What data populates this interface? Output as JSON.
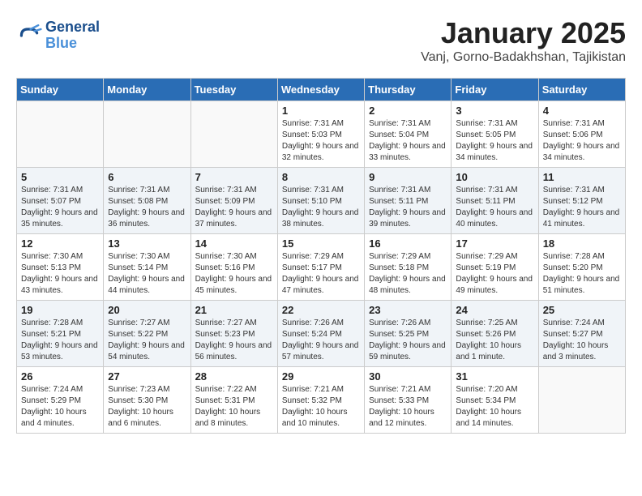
{
  "logo": {
    "line1": "General",
    "line2": "Blue"
  },
  "header": {
    "title": "January 2025",
    "subtitle": "Vanj, Gorno-Badakhshan, Tajikistan"
  },
  "weekdays": [
    "Sunday",
    "Monday",
    "Tuesday",
    "Wednesday",
    "Thursday",
    "Friday",
    "Saturday"
  ],
  "weeks": [
    [
      {
        "day": "",
        "info": ""
      },
      {
        "day": "",
        "info": ""
      },
      {
        "day": "",
        "info": ""
      },
      {
        "day": "1",
        "info": "Sunrise: 7:31 AM\nSunset: 5:03 PM\nDaylight: 9 hours and 32 minutes."
      },
      {
        "day": "2",
        "info": "Sunrise: 7:31 AM\nSunset: 5:04 PM\nDaylight: 9 hours and 33 minutes."
      },
      {
        "day": "3",
        "info": "Sunrise: 7:31 AM\nSunset: 5:05 PM\nDaylight: 9 hours and 34 minutes."
      },
      {
        "day": "4",
        "info": "Sunrise: 7:31 AM\nSunset: 5:06 PM\nDaylight: 9 hours and 34 minutes."
      }
    ],
    [
      {
        "day": "5",
        "info": "Sunrise: 7:31 AM\nSunset: 5:07 PM\nDaylight: 9 hours and 35 minutes."
      },
      {
        "day": "6",
        "info": "Sunrise: 7:31 AM\nSunset: 5:08 PM\nDaylight: 9 hours and 36 minutes."
      },
      {
        "day": "7",
        "info": "Sunrise: 7:31 AM\nSunset: 5:09 PM\nDaylight: 9 hours and 37 minutes."
      },
      {
        "day": "8",
        "info": "Sunrise: 7:31 AM\nSunset: 5:10 PM\nDaylight: 9 hours and 38 minutes."
      },
      {
        "day": "9",
        "info": "Sunrise: 7:31 AM\nSunset: 5:11 PM\nDaylight: 9 hours and 39 minutes."
      },
      {
        "day": "10",
        "info": "Sunrise: 7:31 AM\nSunset: 5:11 PM\nDaylight: 9 hours and 40 minutes."
      },
      {
        "day": "11",
        "info": "Sunrise: 7:31 AM\nSunset: 5:12 PM\nDaylight: 9 hours and 41 minutes."
      }
    ],
    [
      {
        "day": "12",
        "info": "Sunrise: 7:30 AM\nSunset: 5:13 PM\nDaylight: 9 hours and 43 minutes."
      },
      {
        "day": "13",
        "info": "Sunrise: 7:30 AM\nSunset: 5:14 PM\nDaylight: 9 hours and 44 minutes."
      },
      {
        "day": "14",
        "info": "Sunrise: 7:30 AM\nSunset: 5:16 PM\nDaylight: 9 hours and 45 minutes."
      },
      {
        "day": "15",
        "info": "Sunrise: 7:29 AM\nSunset: 5:17 PM\nDaylight: 9 hours and 47 minutes."
      },
      {
        "day": "16",
        "info": "Sunrise: 7:29 AM\nSunset: 5:18 PM\nDaylight: 9 hours and 48 minutes."
      },
      {
        "day": "17",
        "info": "Sunrise: 7:29 AM\nSunset: 5:19 PM\nDaylight: 9 hours and 49 minutes."
      },
      {
        "day": "18",
        "info": "Sunrise: 7:28 AM\nSunset: 5:20 PM\nDaylight: 9 hours and 51 minutes."
      }
    ],
    [
      {
        "day": "19",
        "info": "Sunrise: 7:28 AM\nSunset: 5:21 PM\nDaylight: 9 hours and 53 minutes."
      },
      {
        "day": "20",
        "info": "Sunrise: 7:27 AM\nSunset: 5:22 PM\nDaylight: 9 hours and 54 minutes."
      },
      {
        "day": "21",
        "info": "Sunrise: 7:27 AM\nSunset: 5:23 PM\nDaylight: 9 hours and 56 minutes."
      },
      {
        "day": "22",
        "info": "Sunrise: 7:26 AM\nSunset: 5:24 PM\nDaylight: 9 hours and 57 minutes."
      },
      {
        "day": "23",
        "info": "Sunrise: 7:26 AM\nSunset: 5:25 PM\nDaylight: 9 hours and 59 minutes."
      },
      {
        "day": "24",
        "info": "Sunrise: 7:25 AM\nSunset: 5:26 PM\nDaylight: 10 hours and 1 minute."
      },
      {
        "day": "25",
        "info": "Sunrise: 7:24 AM\nSunset: 5:27 PM\nDaylight: 10 hours and 3 minutes."
      }
    ],
    [
      {
        "day": "26",
        "info": "Sunrise: 7:24 AM\nSunset: 5:29 PM\nDaylight: 10 hours and 4 minutes."
      },
      {
        "day": "27",
        "info": "Sunrise: 7:23 AM\nSunset: 5:30 PM\nDaylight: 10 hours and 6 minutes."
      },
      {
        "day": "28",
        "info": "Sunrise: 7:22 AM\nSunset: 5:31 PM\nDaylight: 10 hours and 8 minutes."
      },
      {
        "day": "29",
        "info": "Sunrise: 7:21 AM\nSunset: 5:32 PM\nDaylight: 10 hours and 10 minutes."
      },
      {
        "day": "30",
        "info": "Sunrise: 7:21 AM\nSunset: 5:33 PM\nDaylight: 10 hours and 12 minutes."
      },
      {
        "day": "31",
        "info": "Sunrise: 7:20 AM\nSunset: 5:34 PM\nDaylight: 10 hours and 14 minutes."
      },
      {
        "day": "",
        "info": ""
      }
    ]
  ]
}
